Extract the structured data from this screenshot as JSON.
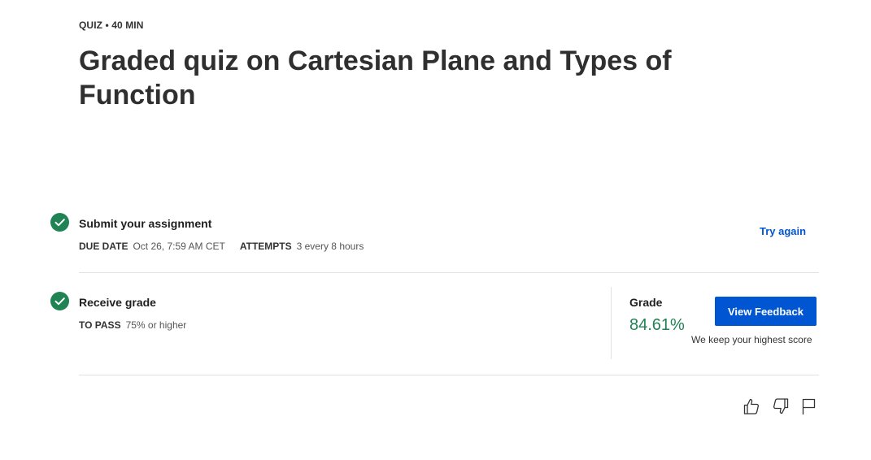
{
  "header": {
    "eyebrow": "QUIZ • 40 MIN",
    "title": "Graded quiz on Cartesian Plane and Types of Function"
  },
  "submit_step": {
    "title": "Submit your assignment",
    "due_date_label": "DUE DATE",
    "due_date_value": "Oct 26, 7:59 AM CET",
    "attempts_label": "ATTEMPTS",
    "attempts_value": "3 every 8 hours",
    "try_again_label": "Try again",
    "status_icon": "check-circle-icon"
  },
  "grade_step": {
    "title": "Receive grade",
    "to_pass_label": "TO PASS",
    "to_pass_value": "75% or higher",
    "grade_label": "Grade",
    "grade_value": "84.61%",
    "view_feedback_label": "View Feedback",
    "highest_score_note": "We keep your highest score",
    "status_icon": "check-circle-icon"
  },
  "feedback_icons": [
    "thumbs-up-icon",
    "thumbs-down-icon",
    "flag-icon"
  ],
  "colors": {
    "accent_blue": "#0056d2",
    "success_green": "#1f8354",
    "divider": "#e1e1e1"
  }
}
